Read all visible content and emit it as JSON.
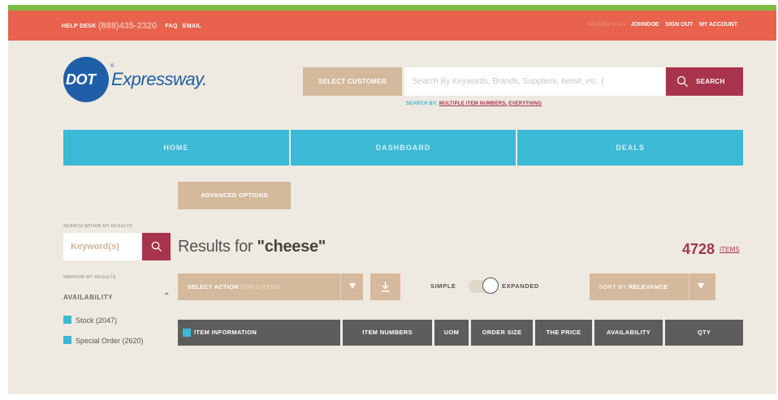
{
  "topbar": {
    "helpdesk_label": "HELP DESK",
    "phone": "(888)435-2320",
    "faq": "FAQ",
    "email": "EMAIL",
    "signed_in_label": "SIGNED IN AS",
    "username": "JOHNDOE",
    "sign_out": "SIGN OUT",
    "my_account": "MY ACCOUNT"
  },
  "logo": {
    "badge": "DOT",
    "tm": "®",
    "name": "Expressway."
  },
  "search": {
    "select_customer": "SELECT CUSTOMER",
    "placeholder": "Search By Keywords, Brands, Suppliers, Item#, etc. (",
    "button": "SEARCH",
    "search_by_label": "SEARCH BY:",
    "search_by_multiple": "MULTIPLE ITEM NUMBERS",
    "search_by_sep": ",",
    "search_by_everything": "EVERYTHING"
  },
  "nav": {
    "items": [
      {
        "label": "HOME"
      },
      {
        "label": "DASHBOARD"
      },
      {
        "label": "DEALS"
      }
    ]
  },
  "advanced_options": "ADVANCED OPTIONS",
  "sidebar": {
    "search_within_label": "SEARCH WITHIN MY RESULTS",
    "keyword_placeholder": "Keyword(s)",
    "narrow_label": "NARROW MY RESULTS",
    "availability_heading": "AVAILABILITY",
    "filters": [
      {
        "label": "Stock (2047)"
      },
      {
        "label": "Special Order (2620)"
      }
    ]
  },
  "results": {
    "prefix": "Results for ",
    "query": "\"cheese\"",
    "count": "4728",
    "count_unit": "ITEMS"
  },
  "actions": {
    "select_action": "SELECT ACTION",
    "select_action_suffix": "FOR 0 ITEMS",
    "view_simple": "SIMPLE",
    "view_expanded": "EXPANDED",
    "sort_prefix": "SORT BY",
    "sort_value": "RELEVANCE"
  },
  "table": {
    "headers": [
      "ITEM INFORMATION",
      "ITEM NUMBERS",
      "UOM",
      "ORDER SIZE",
      "THE PRICE",
      "AVAILABILITY",
      "QTY"
    ]
  },
  "colors": {
    "topbar": "#e8624d",
    "nav": "#3bb9d6",
    "accent": "#a8344c",
    "tan": "#d5b99c",
    "logo_blue": "#1f5fa8",
    "table_header": "#5d5d5d"
  }
}
